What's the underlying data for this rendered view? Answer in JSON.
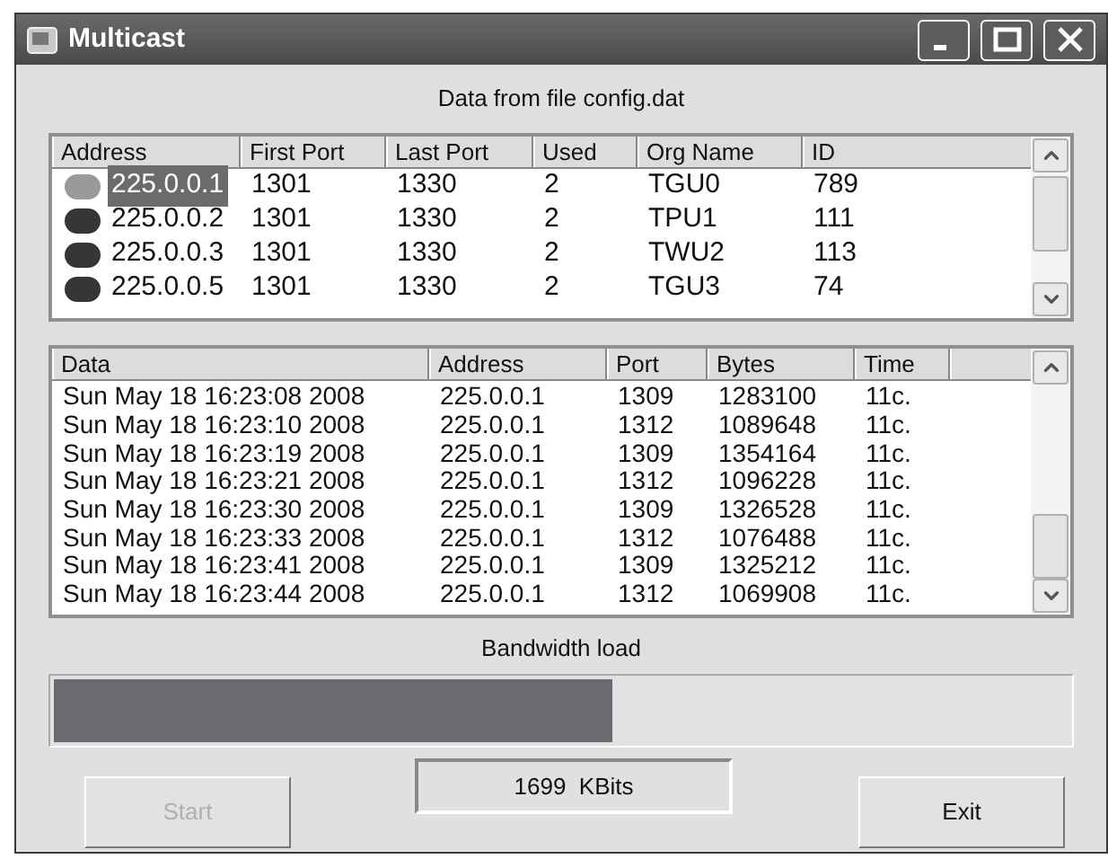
{
  "window": {
    "title": "Multicast"
  },
  "file_label": "Data from file config.dat",
  "groups_table": {
    "columns": [
      "Address",
      "First Port",
      "Last Port",
      "Used",
      "Org Name",
      "ID"
    ],
    "rows": [
      {
        "address": "225.0.0.1",
        "first_port": "1301",
        "last_port": "1330",
        "used": "2",
        "org_name": "TGU0",
        "id": "789",
        "color": "#9a9a9c",
        "selected": true
      },
      {
        "address": "225.0.0.2",
        "first_port": "1301",
        "last_port": "1330",
        "used": "2",
        "org_name": "TPU1",
        "id": "111",
        "color": "#363638",
        "selected": false
      },
      {
        "address": "225.0.0.3",
        "first_port": "1301",
        "last_port": "1330",
        "used": "2",
        "org_name": "TWU2",
        "id": "113",
        "color": "#363638",
        "selected": false
      },
      {
        "address": "225.0.0.5",
        "first_port": "1301",
        "last_port": "1330",
        "used": "2",
        "org_name": "TGU3",
        "id": "74",
        "color": "#363638",
        "selected": false
      }
    ]
  },
  "log_table": {
    "columns": [
      "Data",
      "Address",
      "Port",
      "Bytes",
      "Time"
    ],
    "rows": [
      {
        "data": "Sun May 18 16:23:08 2008",
        "address": "225.0.0.1",
        "port": "1309",
        "bytes": "1283100",
        "time": "11c."
      },
      {
        "data": "Sun May 18 16:23:10 2008",
        "address": "225.0.0.1",
        "port": "1312",
        "bytes": "1089648",
        "time": "11c."
      },
      {
        "data": "Sun May 18 16:23:19 2008",
        "address": "225.0.0.1",
        "port": "1309",
        "bytes": "1354164",
        "time": "11c."
      },
      {
        "data": "Sun May 18 16:23:21 2008",
        "address": "225.0.0.1",
        "port": "1312",
        "bytes": "1096228",
        "time": "11c."
      },
      {
        "data": "Sun May 18 16:23:30 2008",
        "address": "225.0.0.1",
        "port": "1309",
        "bytes": "1326528",
        "time": "11c."
      },
      {
        "data": "Sun May 18 16:23:33 2008",
        "address": "225.0.0.1",
        "port": "1312",
        "bytes": "1076488",
        "time": "11c."
      },
      {
        "data": "Sun May 18 16:23:41 2008",
        "address": "225.0.0.1",
        "port": "1309",
        "bytes": "1325212",
        "time": "11c."
      },
      {
        "data": "Sun May 18 16:23:44 2008",
        "address": "225.0.0.1",
        "port": "1312",
        "bytes": "1069908",
        "time": "11c."
      }
    ]
  },
  "bandwidth": {
    "label": "Bandwidth load",
    "level": 0.55,
    "reading": "1699  KBits"
  },
  "buttons": [
    {
      "label": "Start",
      "disabled": true
    },
    {
      "label": "Exit",
      "disabled": false
    }
  ]
}
